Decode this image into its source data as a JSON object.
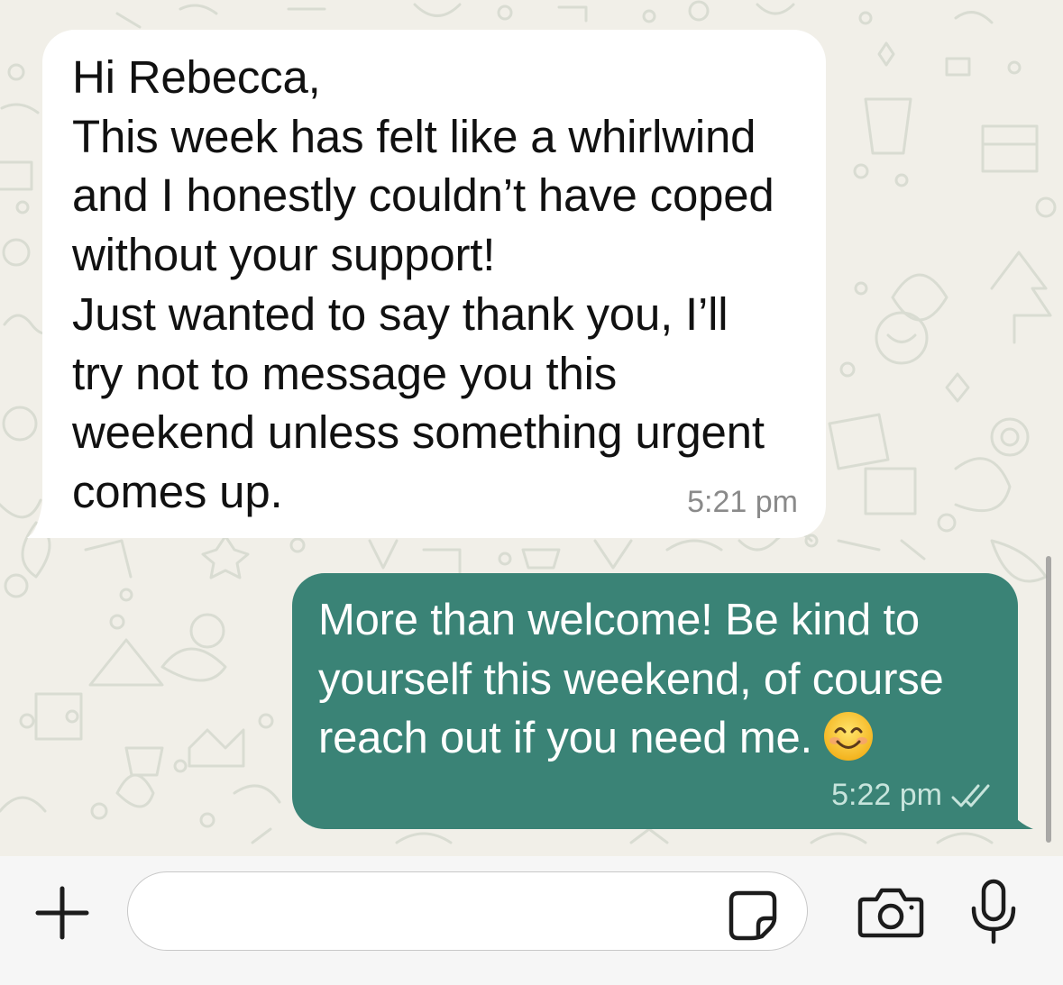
{
  "chat": {
    "messages": [
      {
        "direction": "incoming",
        "text": "Hi Rebecca,\nThis week has felt like a whirlwind\nand I honestly couldn’t have coped\nwithout your support!\nJust wanted to say thank you, I’ll\ntry not to message you this\nweekend unless something urgent\ncomes up.",
        "time": "5:21 pm"
      },
      {
        "direction": "outgoing",
        "text": "More than welcome! Be kind to\nyourself this weekend, of course\nreach out if you need me.",
        "emoji": "smiling-face-icon",
        "time": "5:22 pm",
        "status": "double-check-icon"
      }
    ]
  },
  "composer": {
    "input_value": "",
    "icons": {
      "attach": "plus-icon",
      "sticker": "sticker-icon",
      "camera": "camera-icon",
      "mic": "microphone-icon"
    }
  },
  "colors": {
    "background": "#f1efe8",
    "incoming_bubble": "#ffffff",
    "outgoing_bubble": "#3a8376",
    "outgoing_time": "#c7e4dc",
    "incoming_time": "#8a8a8a"
  }
}
